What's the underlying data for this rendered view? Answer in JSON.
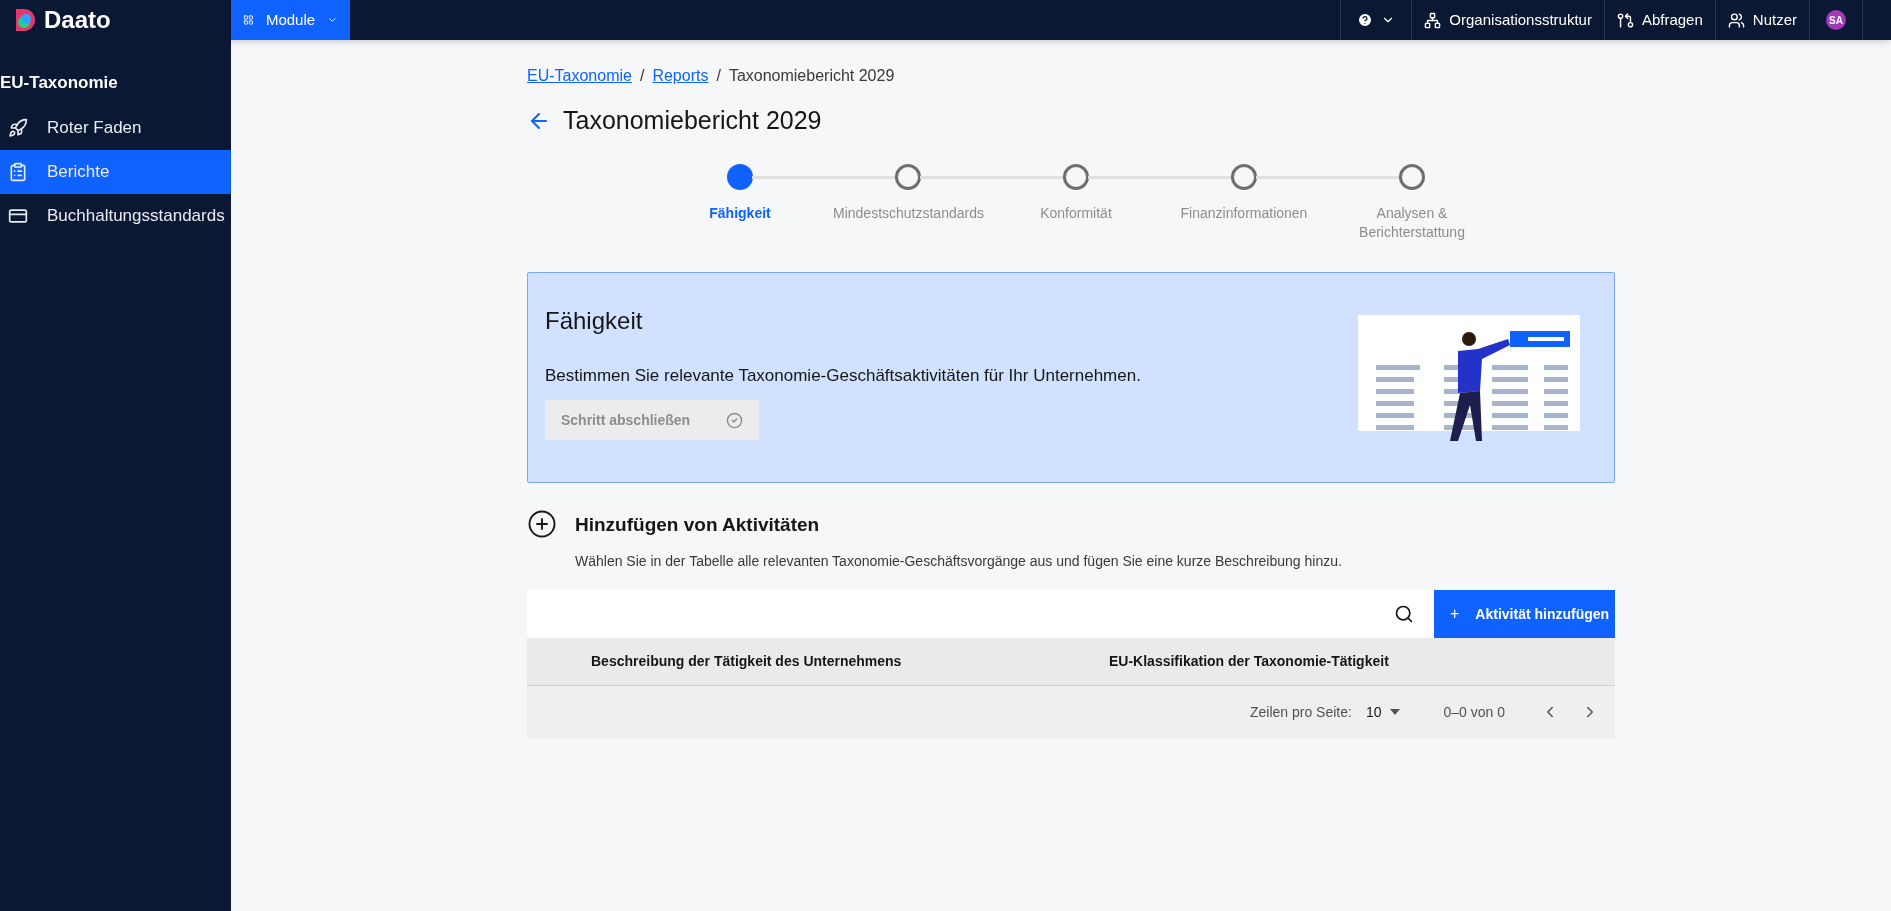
{
  "topbar": {
    "logo": "Daato",
    "module_button": "Module",
    "links": [
      {
        "kind": "help"
      },
      {
        "kind": "org",
        "label": "Organisationsstruktur"
      },
      {
        "kind": "queries",
        "label": "Abfragen"
      },
      {
        "kind": "users",
        "label": "Nutzer"
      }
    ],
    "avatar": "SA"
  },
  "sidebar": {
    "title": "EU-Taxonomie",
    "items": [
      {
        "kind": "rocket",
        "label": "Roter Faden",
        "selected": false
      },
      {
        "kind": "clipboard",
        "label": "Berichte",
        "selected": true
      },
      {
        "kind": "card",
        "label": "Buchhaltungsstandards",
        "selected": false
      }
    ]
  },
  "breadcrumb": {
    "separator": "/",
    "items": [
      {
        "label": "EU-Taxonomie",
        "link": true
      },
      {
        "label": "Reports",
        "link": true
      },
      {
        "label": "Taxonomiebericht 2029",
        "link": false
      }
    ]
  },
  "page_title": "Taxonomiebericht 2029",
  "steps": [
    {
      "label": "Fähigkeit",
      "selected": true
    },
    {
      "label": "Mindestschutzstandards",
      "selected": false
    },
    {
      "label": "Konformität",
      "selected": false
    },
    {
      "label": "Finanzinformationen",
      "selected": false
    },
    {
      "label": "Analysen & Berichterstattung",
      "selected": false
    }
  ],
  "step_card": {
    "title": "Fähigkeit",
    "description": "Bestimmen Sie relevante Taxonomie-Geschäftsaktivitäten für Ihr Unternehmen.",
    "button": {
      "label": "Schritt abschließen",
      "disabled": true
    }
  },
  "activities": {
    "title": "Hinzufügen von Aktivitäten",
    "description": "Wählen Sie in der Tabelle alle relevanten Taxonomie-Geschäftsvorgänge aus und fügen Sie eine kurze Beschreibung hinzu.",
    "add_button": "Aktivität hinzufügen",
    "add_button_icon": "+",
    "table": {
      "columns": [
        "Beschreibung der Tätigkeit des Unternehmens",
        "EU-Klassifikation der Taxonomie-Tätigkeit"
      ],
      "pagination": {
        "rows_label": "Zeilen pro Seite:",
        "rows_value": "10",
        "range": "0–0 von 0"
      }
    }
  }
}
